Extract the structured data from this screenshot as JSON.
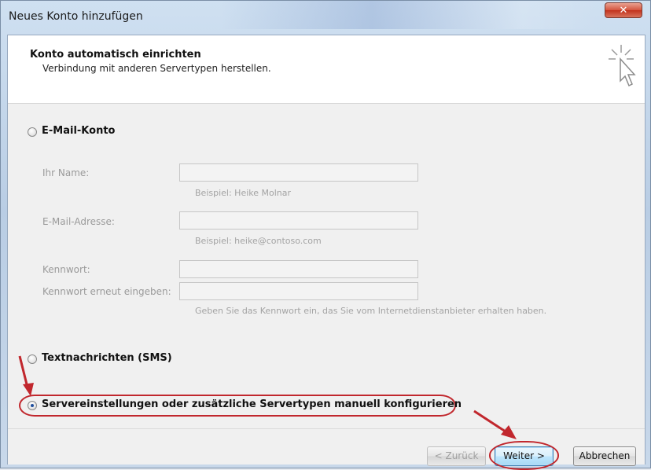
{
  "window": {
    "title": "Neues Konto hinzufügen",
    "close_glyph": "✕"
  },
  "header": {
    "title": "Konto automatisch einrichten",
    "subtitle": "Verbindung mit anderen Servertypen herstellen.",
    "icon": "wizard-cursor-icon"
  },
  "email_account": {
    "label": "E-Mail-Konto",
    "selected": false,
    "fields": {
      "name_label": "Ihr Name:",
      "name_hint": "Beispiel: Heike Molnar",
      "email_label": "E-Mail-Adresse:",
      "email_hint": "Beispiel: heike@contoso.com",
      "password_label": "Kennwort:",
      "password_repeat_label": "Kennwort erneut eingeben:",
      "password_hint": "Geben Sie das Kennwort ein, das Sie vom Internetdienstanbieter erhalten haben."
    }
  },
  "sms_option": {
    "label": "Textnachrichten (SMS)",
    "selected": false
  },
  "manual_option": {
    "label": "Servereinstellungen oder zusätzliche Servertypen manuell konfigurieren",
    "selected": true
  },
  "buttons": {
    "back": "< Zurück",
    "next": "Weiter >",
    "cancel": "Abbrechen"
  },
  "colors": {
    "annotation": "#c1272d"
  }
}
